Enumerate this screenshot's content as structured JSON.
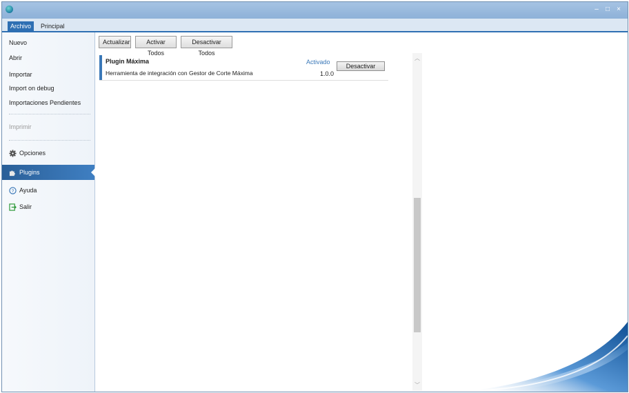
{
  "window": {
    "controls": {
      "minimize": "–",
      "maximize": "□",
      "close": "×"
    }
  },
  "tabs": [
    {
      "label": "Archivo",
      "active": true
    },
    {
      "label": "Principal",
      "active": false
    }
  ],
  "sidebar": {
    "items": [
      {
        "label": "Nuevo"
      },
      {
        "label": "Abrir"
      },
      {
        "label": "Importar"
      },
      {
        "label": "Import on debug"
      },
      {
        "label": "Importaciones Pendientes"
      },
      {
        "label": "Imprimir",
        "disabled": true
      },
      {
        "label": "Opciones",
        "icon": "gear-icon"
      },
      {
        "label": "Plugins",
        "icon": "puzzle-icon",
        "selected": true
      },
      {
        "label": "Ayuda",
        "icon": "help-icon"
      },
      {
        "label": "Salir",
        "icon": "exit-icon"
      }
    ]
  },
  "toolbar": {
    "refresh_label": "Actualizar",
    "activate_all_label": "Activar Todos",
    "deactivate_all_label": "Desactivar Todos"
  },
  "plugins": [
    {
      "name": "Plugin Máxima",
      "description": "Herramienta de integración con Gestor de Corte Máxima",
      "status": "Activado",
      "version": "1.0.0",
      "action_label": "Desactivar"
    }
  ],
  "colors": {
    "accent": "#3a78b8",
    "selected_bg": "#2a5f98",
    "titlebar": "#a6c3e3"
  }
}
